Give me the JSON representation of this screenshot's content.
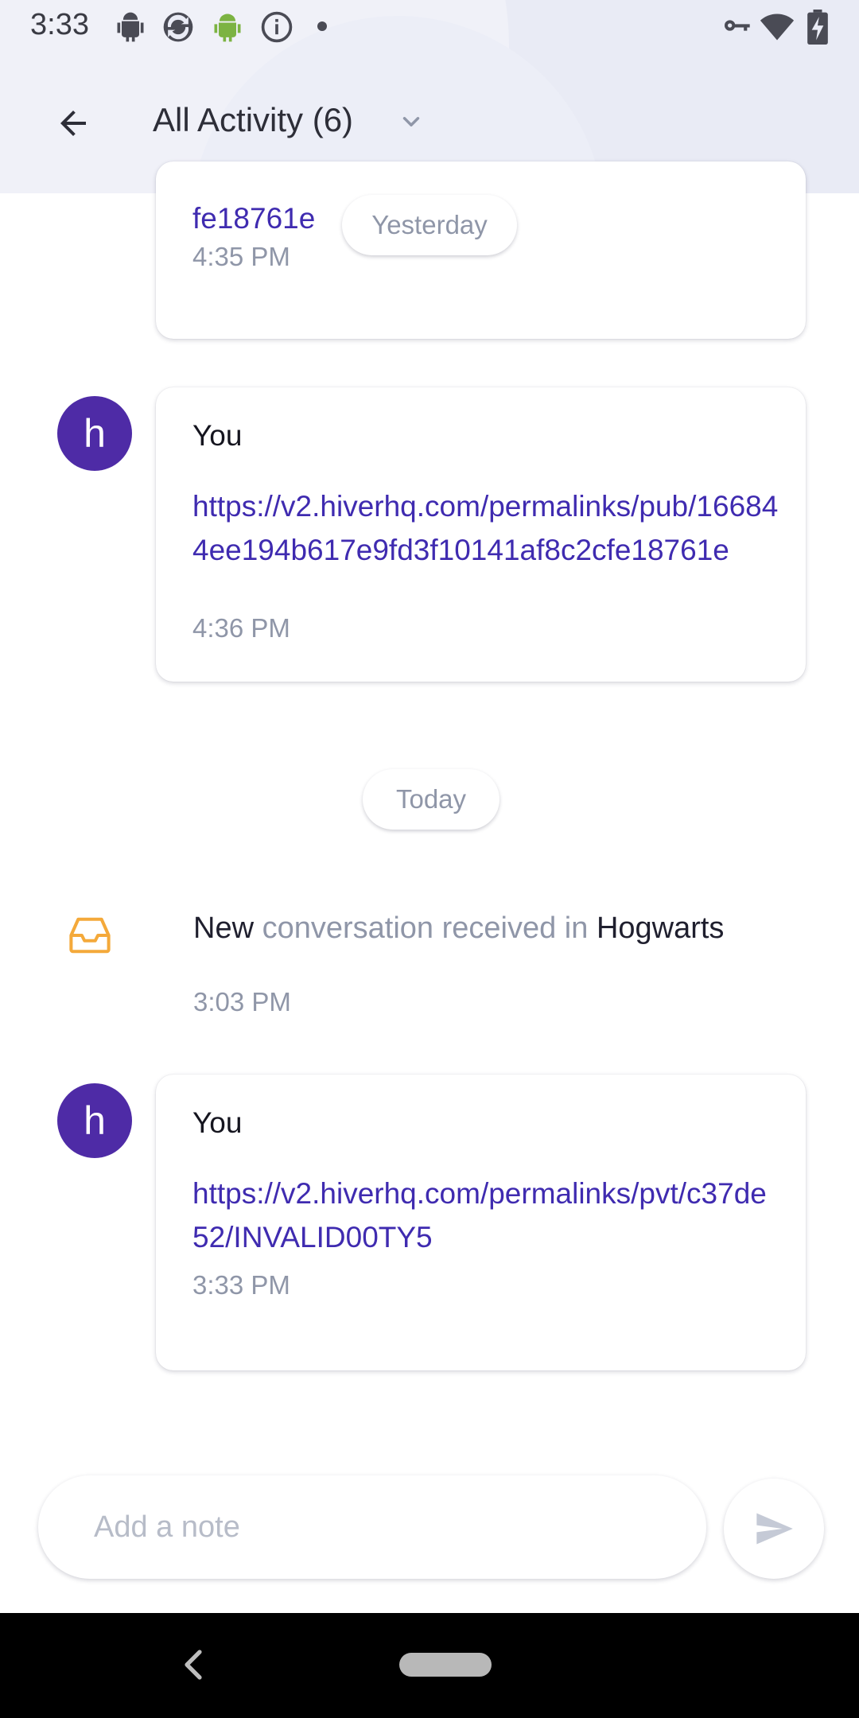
{
  "status_bar": {
    "time": "3:33",
    "icons": [
      "android-debug-icon",
      "sync-icon",
      "android-icon",
      "info-icon",
      "dot-icon",
      "vpn-key-icon",
      "wifi-icon",
      "battery-charging-icon"
    ]
  },
  "header": {
    "title": "All Activity (6)",
    "back_icon": "back-arrow-icon",
    "dropdown_icon": "chevron-down-icon"
  },
  "feed": {
    "partial_card": {
      "link_tail": "fe18761e",
      "time": "4:35 PM"
    },
    "date_pill_yesterday": "Yesterday",
    "note_1": {
      "avatar_letter": "h",
      "author": "You",
      "link": "https://v2.hiverhq.com/permalinks/pub/166844ee194b617e9fd3f10141af8c2cfe18761e",
      "time": "4:36 PM"
    },
    "date_pill_today": "Today",
    "activity": {
      "icon": "inbox-icon",
      "word_new": "New",
      "middle": "conversation received in",
      "mailbox": "Hogwarts",
      "time": "3:03 PM"
    },
    "note_2": {
      "avatar_letter": "h",
      "author": "You",
      "link": "https://v2.hiverhq.com/permalinks/pvt/c37de52/INVALID00TY5",
      "time": "3:33 PM"
    }
  },
  "composer": {
    "placeholder": "Add a note",
    "send_icon": "send-icon"
  },
  "nav_bar": {
    "back_icon": "nav-back-icon",
    "home_icon": "home-pill-icon"
  },
  "colors": {
    "accent": "#3f2bb0",
    "avatar": "#4e2ba6",
    "inbox_icon": "#f4a93a",
    "muted_text": "#8f96a8",
    "header_bg": "#e9ebf5"
  }
}
